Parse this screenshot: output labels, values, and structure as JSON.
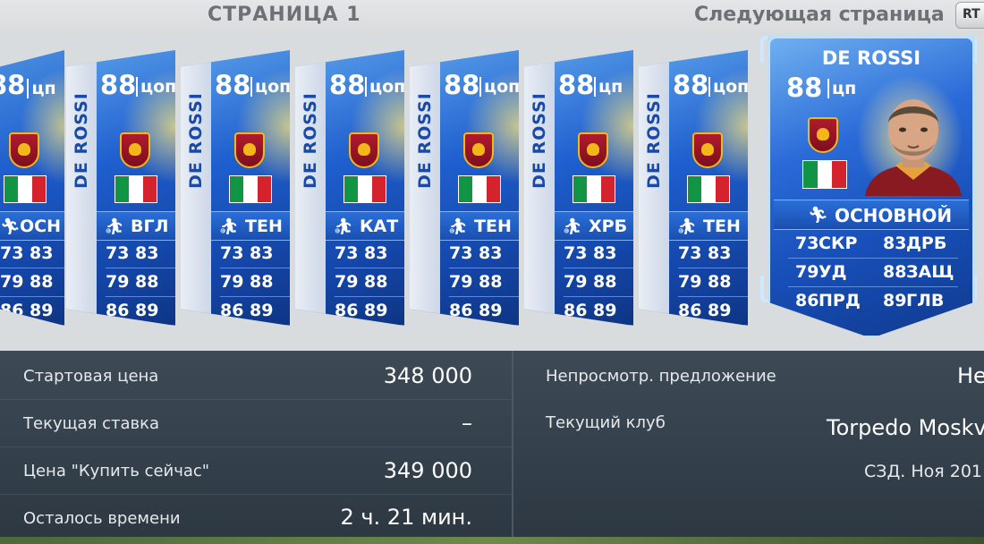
{
  "header": {
    "page_title": "СТРАНИЦА 1",
    "next_page": "Следующая страница",
    "rt_button": "RT"
  },
  "colors": {
    "card_blue": "#1f5fcf",
    "name_strip_text": "#1a4aa8",
    "panel_bg": "#34414c",
    "header_text": "#6d7175"
  },
  "stack_cards": [
    {
      "name": "DE ROSSI",
      "rating": "88",
      "pos": "цп",
      "role": "ОСН",
      "role_icon": "player-standing-icon",
      "stats": [
        "73 83",
        "79 88",
        "86 89"
      ]
    },
    {
      "name": "DE ROSSI",
      "rating": "88",
      "pos": "цоп",
      "role": "ВГЛ",
      "role_icon": "player-sliding-icon",
      "stats": [
        "73 83",
        "79 88",
        "86 89"
      ]
    },
    {
      "name": "DE ROSSI",
      "rating": "88",
      "pos": "цоп",
      "role": "ТЕН",
      "role_icon": "player-kicking-icon",
      "stats": [
        "73 83",
        "79 88",
        "86 89"
      ]
    },
    {
      "name": "DE ROSSI",
      "rating": "88",
      "pos": "цоп",
      "role": "КАТ",
      "role_icon": "player-kicking-icon",
      "stats": [
        "73 83",
        "79 88",
        "86 89"
      ]
    },
    {
      "name": "DE ROSSI",
      "rating": "88",
      "pos": "цоп",
      "role": "ТЕН",
      "role_icon": "player-kicking-icon",
      "stats": [
        "73 83",
        "79 88",
        "86 89"
      ]
    },
    {
      "name": "DE ROSSI",
      "rating": "88",
      "pos": "цп",
      "role": "ХРБ",
      "role_icon": "player-diving-icon",
      "stats": [
        "73 83",
        "79 88",
        "86 89"
      ]
    },
    {
      "name": "DE ROSSI",
      "rating": "88",
      "pos": "цоп",
      "role": "ТЕН",
      "role_icon": "player-kicking-icon",
      "stats": [
        "73 83",
        "79 88",
        "86 89"
      ]
    }
  ],
  "featured_card": {
    "name": "DE ROSSI",
    "rating": "88",
    "pos": "цп",
    "role": "ОСНОВНОЙ",
    "stats": [
      {
        "val": "73",
        "label": "СКР"
      },
      {
        "val": "83",
        "label": "ДРБ"
      },
      {
        "val": "79",
        "label": "УД"
      },
      {
        "val": "88",
        "label": "ЗАЩ"
      },
      {
        "val": "86",
        "label": "ПРД"
      },
      {
        "val": "89",
        "label": "ГЛВ"
      }
    ]
  },
  "info": {
    "start_price_label": "Стартовая цена",
    "start_price": "348 000",
    "current_bid_label": "Текущая ставка",
    "current_bid": "–",
    "buy_now_label": "Цена \"Купить сейчас\"",
    "buy_now": "349 000",
    "time_left_label": "Осталось времени",
    "time_left": "2 ч. 21 мин.",
    "unseen_offer_label": "Непросмотр. предложение",
    "unseen_offer": "Не",
    "current_club_label": "Текущий клуб",
    "current_club": "Torpedo Moskv",
    "date_text": "СЗД. Ноя 201"
  }
}
